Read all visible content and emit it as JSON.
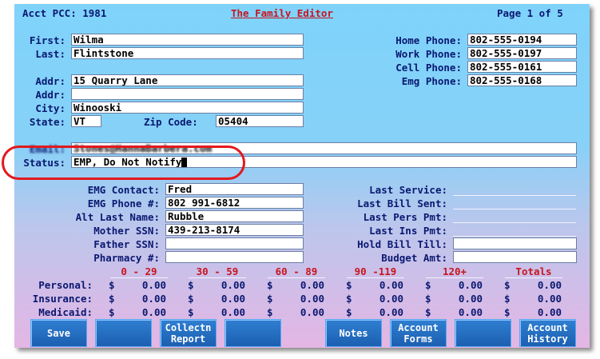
{
  "header": {
    "acct": "Acct PCC: 1981",
    "title": "The Family Editor",
    "page": "Page 1 of 5"
  },
  "person": {
    "first_label": "First:",
    "first": "Wilma",
    "last_label": "Last:",
    "last": "Flintstone",
    "addr_label": "Addr:",
    "addr1": "15 Quarry Lane",
    "addr2": "",
    "city_label": "City:",
    "city": "Winooski",
    "state_label": "State:",
    "state": "VT",
    "zip_label": "Zip Code:",
    "zip": "05404",
    "email_label": "Email:",
    "email": "Stones@HannaBarbera.com",
    "status_label": "Status:",
    "status": "EMP, Do Not Notify"
  },
  "phones": {
    "home_label": "Home Phone:",
    "home": "802-555-0194",
    "work_label": "Work Phone:",
    "work": "802-555-0197",
    "cell_label": "Cell Phone:",
    "cell": "802-555-0161",
    "emg_label": "Emg Phone:",
    "emg": "802-555-0168"
  },
  "emergency": {
    "contact_label": "EMG Contact:",
    "contact": "Fred",
    "phone_label": "EMG Phone #:",
    "phone": "802 991-6812",
    "alt_last_label": "Alt Last Name:",
    "alt_last": "Rubble",
    "mother_label": "Mother SSN:",
    "mother": "439-213-8174",
    "father_label": "Father SSN:",
    "father": "",
    "pharmacy_label": "Pharmacy #:",
    "pharmacy": ""
  },
  "billing": {
    "last_service": "Last Service:",
    "last_bill": "Last Bill Sent:",
    "last_pers": "Last Pers Pmt:",
    "last_ins": "Last Ins Pmt:",
    "hold_bill": "Hold Bill Till:",
    "budget": "Budget Amt:"
  },
  "aging": {
    "columns": [
      "0 - 29",
      "30 - 59",
      "60 - 89",
      "90 -119",
      "120+",
      "Totals"
    ],
    "rows": [
      {
        "label": "Personal:",
        "values": [
          "0.00",
          "0.00",
          "0.00",
          "0.00",
          "0.00",
          "0.00"
        ]
      },
      {
        "label": "Insurance:",
        "values": [
          "0.00",
          "0.00",
          "0.00",
          "0.00",
          "0.00",
          "0.00"
        ]
      },
      {
        "label": "Medicaid:",
        "values": [
          "0.00",
          "0.00",
          "0.00",
          "0.00",
          "0.00",
          "0.00"
        ]
      }
    ],
    "currency": "$"
  },
  "buttons": [
    "Save",
    "",
    "Collectn\nReport",
    "",
    "Notes",
    "Account\nForms",
    "",
    "Account\nHistory"
  ],
  "colors": {
    "title": "#c8141e",
    "label": "#0a1870",
    "button": "#1f63b5",
    "highlight": "#e2191e"
  }
}
